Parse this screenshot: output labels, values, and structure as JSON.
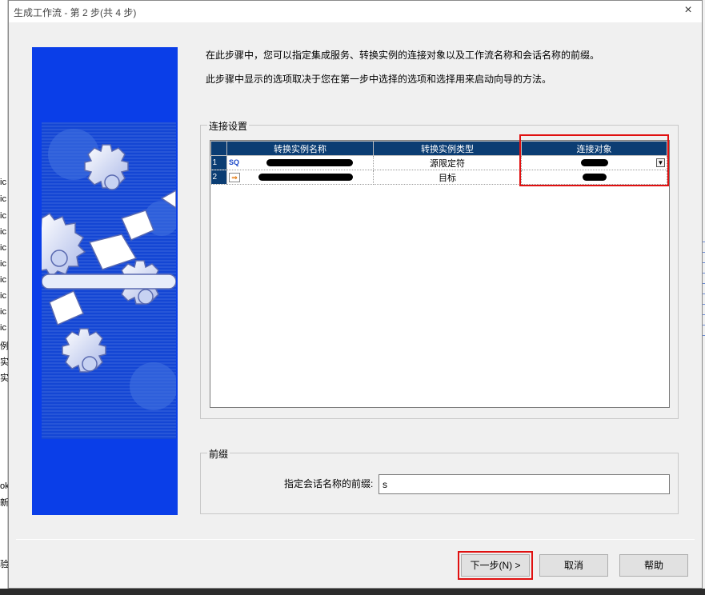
{
  "window": {
    "title": "生成工作流 - 第 2 步(共 4 步)",
    "close_glyph": "×"
  },
  "intro": {
    "line1": "在此步骤中，您可以指定集成服务、转换实例的连接对象以及工作流名称和会话名称的前缀。",
    "line2": "此步骤中显示的选项取决于您在第一步中选择的选项和选择用来启动向导的方法。"
  },
  "connection_group": {
    "title": "连接设置",
    "columns": [
      "转换实例名称",
      "转换实例类型",
      "连接对象"
    ],
    "rows": [
      {
        "num": "1",
        "icon": "source-qualifier-icon",
        "icon_text": "SQ",
        "type": "源限定符",
        "dropdown_glyph": "▼"
      },
      {
        "num": "2",
        "icon": "target-icon",
        "icon_text": "⇒",
        "type": "目标"
      }
    ]
  },
  "prefix_group": {
    "title": "前缀",
    "label": "指定会话名称的前缀:",
    "value": "s"
  },
  "buttons": {
    "next": "下一步(N) >",
    "cancel": "取消",
    "help": "帮助"
  },
  "background_fragments": [
    "ic",
    "ic",
    "ic",
    "ic",
    "ic",
    "ic",
    "ic",
    "ic",
    "ic",
    "ic",
    "例",
    "实",
    "实",
    "ok",
    "新",
    "验"
  ],
  "colors": {
    "side_panel": "#0a3ee8",
    "grid_header": "#0b3d73",
    "highlight": "#e01010"
  }
}
